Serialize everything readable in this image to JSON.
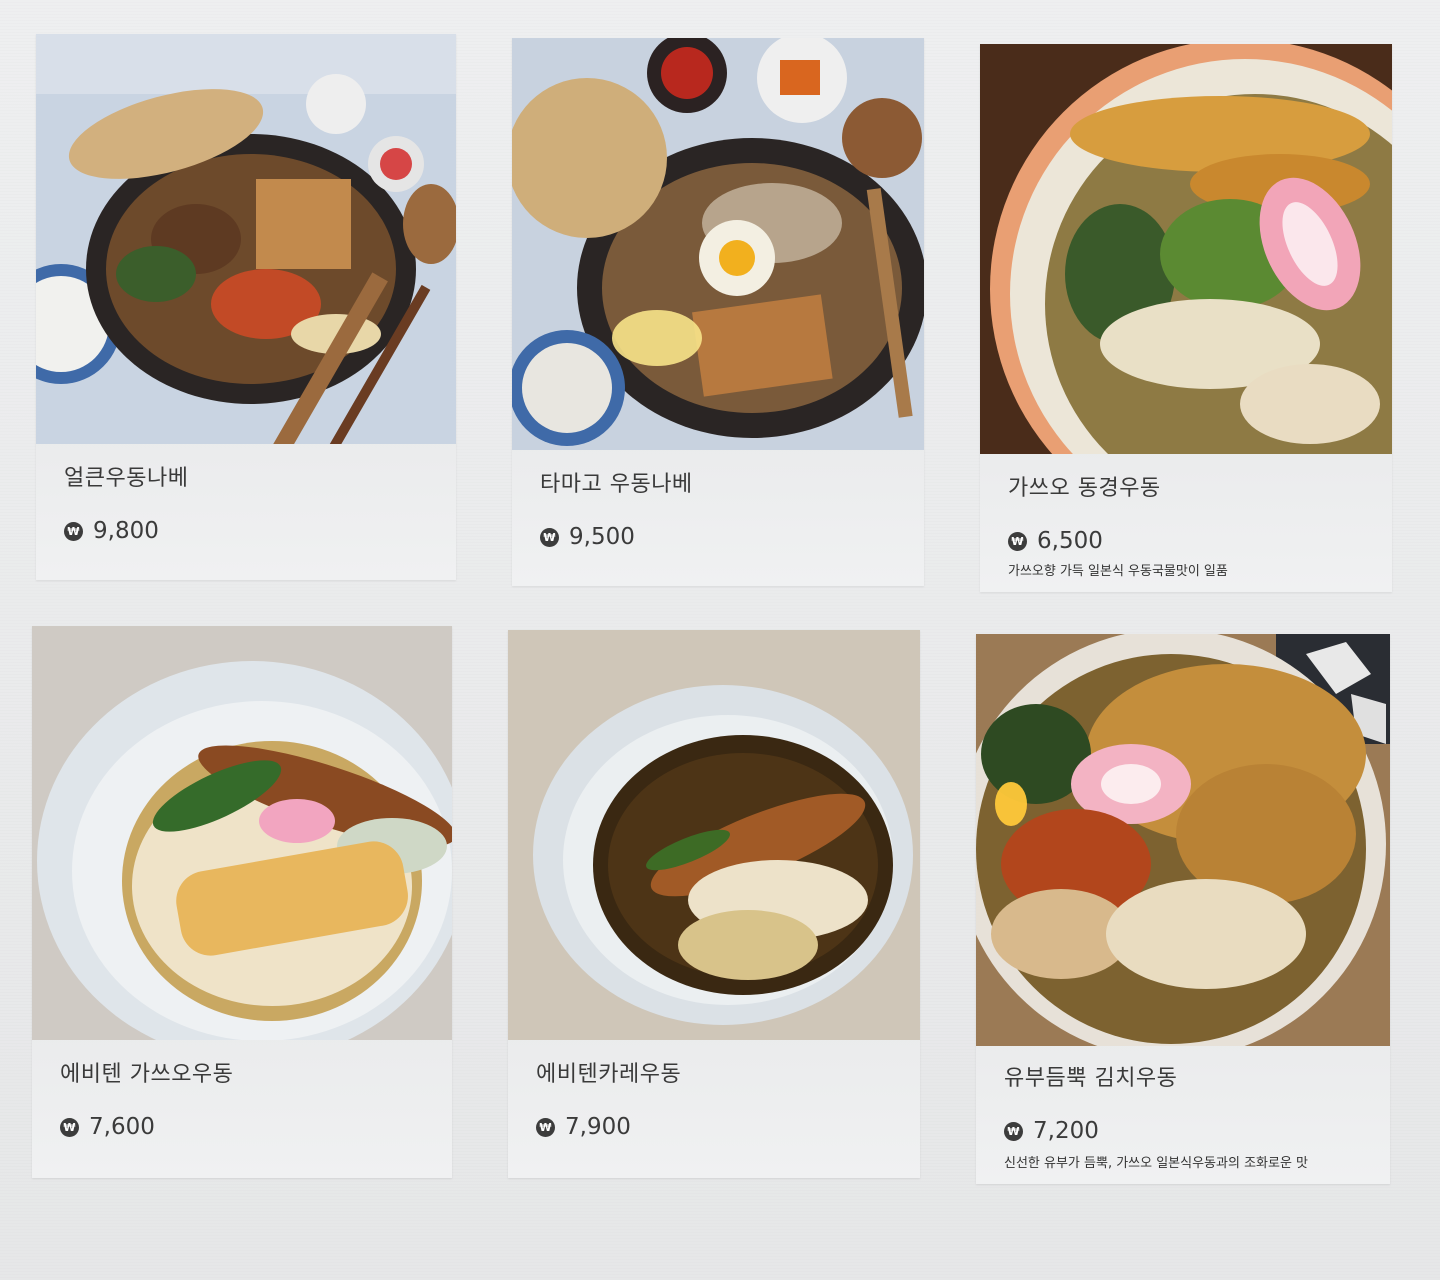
{
  "menu": {
    "currency_symbol": "₩",
    "items": [
      {
        "name": "얼큰우동나베",
        "price": "9,800",
        "description": "",
        "photo_icon": "nabe-udon-spicy-photo"
      },
      {
        "name": "타마고 우동나베",
        "price": "9,500",
        "description": "",
        "photo_icon": "nabe-udon-egg-photo"
      },
      {
        "name": "가쓰오 동경우동",
        "price": "6,500",
        "description": "가쓰오향 가득 일본식 우동국물맛이 일품",
        "photo_icon": "tokyo-udon-photo"
      },
      {
        "name": "에비텐 가쓰오우동",
        "price": "7,600",
        "description": "",
        "photo_icon": "ebiten-udon-photo"
      },
      {
        "name": "에비텐카레우동",
        "price": "7,900",
        "description": "",
        "photo_icon": "ebiten-curry-udon-photo"
      },
      {
        "name": "유부듬뿍 김치우동",
        "price": "7,200",
        "description": "신선한 유부가 듬뿍, 가쓰오 일본식우동과의 조화로운 맛",
        "photo_icon": "yubu-kimchi-udon-photo"
      }
    ]
  },
  "colors": {
    "background": "#e9eaeb",
    "card": "#e4e5e6",
    "text": "#3a3a3a"
  }
}
